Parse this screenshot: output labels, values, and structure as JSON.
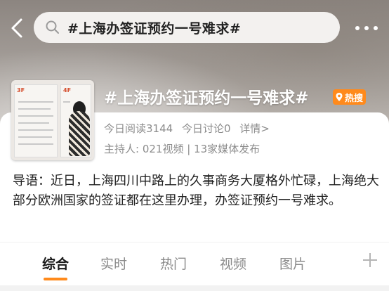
{
  "search": {
    "query": "#上海办签证预约一号难求#"
  },
  "topic": {
    "title": "#上海办签证预约一号难求#",
    "badge": "热搜",
    "reads": "今日阅读3144",
    "discussions": "今日讨论0",
    "detail_link": "详情>",
    "host": "主持人: 021视频 | 13家媒体发布"
  },
  "thumbnail": {
    "floor_left": "3F",
    "floor_right": "4F"
  },
  "intro": "导语：近日，上海四川中路上的久事商务大厦格外忙碌，上海绝大部分欧洲国家的签证都在这里办理，办签证预约一号难求。",
  "tabs": [
    {
      "label": "综合",
      "active": true
    },
    {
      "label": "实时",
      "active": false
    },
    {
      "label": "热门",
      "active": false
    },
    {
      "label": "视频",
      "active": false
    },
    {
      "label": "图片",
      "active": false
    }
  ],
  "icons": {
    "back": "back-arrow-icon",
    "search": "search-icon",
    "more": "more-dots-icon",
    "hot": "location-pin-icon",
    "add": "plus-icon"
  },
  "colors": {
    "accent": "#ff8a1c",
    "muted": "#8c8c8c",
    "text": "#222222"
  }
}
